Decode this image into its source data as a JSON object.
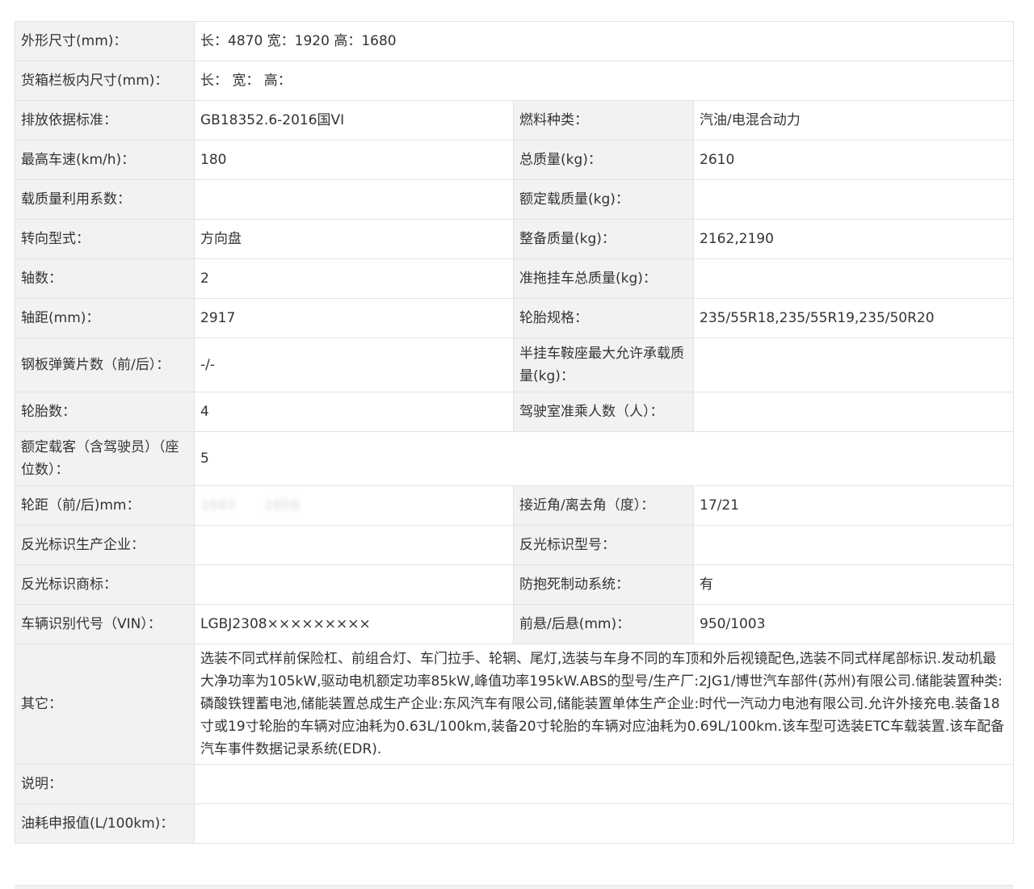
{
  "rows": [
    {
      "label": "外形尺寸(mm)：",
      "value": "长：4870 宽：1920 高：1680"
    },
    {
      "label": "货箱栏板内尺寸(mm)：",
      "value": "长：  宽：  高："
    },
    {
      "label": "排放依据标准：",
      "value": "GB18352.6-2016国VI",
      "label2": "燃料种类：",
      "value2": "汽油/电混合动力"
    },
    {
      "label": "最高车速(km/h)：",
      "value": "180",
      "label2": "总质量(kg)：",
      "value2": "2610"
    },
    {
      "label": "载质量利用系数：",
      "value": "",
      "label2": "额定载质量(kg)：",
      "value2": ""
    },
    {
      "label": "转向型式：",
      "value": "方向盘",
      "label2": "整备质量(kg)：",
      "value2": "2162,2190"
    },
    {
      "label": "轴数：",
      "value": "2",
      "label2": "准拖挂车总质量(kg)：",
      "value2": ""
    },
    {
      "label": "轴距(mm)：",
      "value": "2917",
      "label2": "轮胎规格：",
      "value2": "235/55R18,235/55R19,235/50R20"
    },
    {
      "label": "钢板弹簧片数（前/后）：",
      "value": "-/-",
      "label2": "半挂车鞍座最大允许承载质量(kg)：",
      "value2": ""
    },
    {
      "label": "轮胎数：",
      "value": "4",
      "label2": "驾驶室准乘人数（人）：",
      "value2": ""
    },
    {
      "label": "额定载客（含驾驶员）（座位数）：",
      "value": "5"
    },
    {
      "label": "轮距（前/后)mm：",
      "value_blur_front": "1643",
      "value_blur_rear": "1659",
      "label2": "接近角/离去角（度）：",
      "value2": "17/21"
    },
    {
      "label": "反光标识生产企业：",
      "value": "",
      "label2": "反光标识型号：",
      "value2": ""
    },
    {
      "label": "反光标识商标：",
      "value": "",
      "label2": "防抱死制动系统：",
      "value2": "有"
    },
    {
      "label": "车辆识别代号（VIN）：",
      "value": "LGBJ2308×××××××××",
      "label2": "前悬/后悬(mm)：",
      "value2": "950/1003"
    },
    {
      "label": "其它：",
      "value": "选装不同式样前保险杠、前组合灯、车门拉手、轮辋、尾灯,选装与车身不同的车顶和外后视镜配色,选装不同式样尾部标识.发动机最大净功率为105kW,驱动电机额定功率85kW,峰值功率195kW.ABS的型号/生产厂:2JG1/博世汽车部件(苏州)有限公司.储能装置种类:磷酸铁锂蓄电池,储能装置总成生产企业:东风汽车有限公司,储能装置单体生产企业:时代一汽动力电池有限公司.允许外接充电.装备18寸或19寸轮胎的车辆对应油耗为0.63L/100km,装备20寸轮胎的车辆对应油耗为0.69L/100km.该车型可选装ETC车载装置.该车配备汽车事件数据记录系统(EDR)."
    },
    {
      "label": "说明：",
      "value": ""
    },
    {
      "label": "油耗申报值(L/100km)：",
      "value": ""
    }
  ]
}
